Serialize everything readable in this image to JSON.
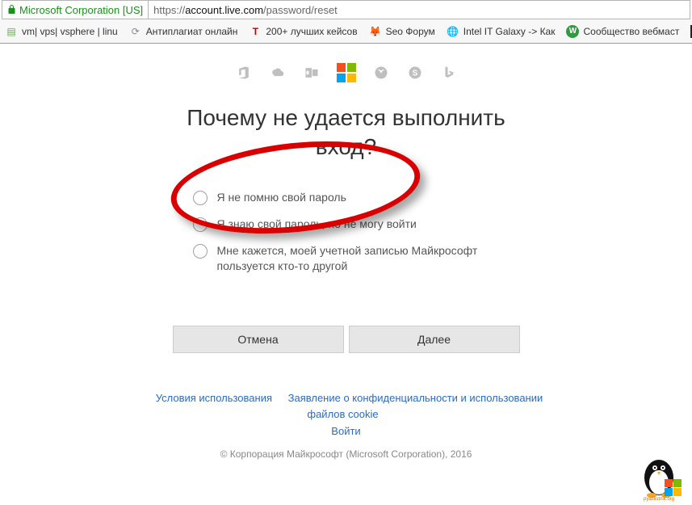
{
  "addressBar": {
    "sslLabel": "Microsoft Corporation [US]",
    "urlScheme": "https://",
    "urlHost": "account.live.com",
    "urlPath": "/password/reset"
  },
  "bookmarks": [
    {
      "label": "vm| vps| vsphere | linu",
      "icon": "page-icon",
      "color": "#6aa84f"
    },
    {
      "label": "Антиплагиат онлайн",
      "icon": "reload-icon",
      "color": "#888"
    },
    {
      "label": "200+ лучших кейсов",
      "icon": "letter-t-icon",
      "color": "#c00"
    },
    {
      "label": "Seo Форум",
      "icon": "fox-icon",
      "color": "#f28c1a"
    },
    {
      "label": "Intel IT Galaxy -> Как",
      "icon": "globe-icon",
      "color": "#1a73e8"
    },
    {
      "label": "Сообщество вебмаст",
      "icon": "letter-w-icon",
      "color": "#2e9c3d"
    },
    {
      "label": "",
      "icon": "dark-square-icon",
      "color": "#222"
    }
  ],
  "headline": "Почему не удается выполнить вход?",
  "options": [
    {
      "label": "Я не помню свой пароль"
    },
    {
      "label": "Я знаю свой пароль, но не могу войти"
    },
    {
      "label": "Мне кажется, моей учетной записью Майкрософт пользуется кто-то другой"
    }
  ],
  "buttons": {
    "cancel": "Отмена",
    "next": "Далее"
  },
  "footer": {
    "terms": "Условия использования",
    "privacy": "Заявление о конфиденциальности и использовании файлов cookie",
    "signin": "Войти",
    "copyright": "© Корпорация Майкрософт (Microsoft Corporation), 2016"
  }
}
